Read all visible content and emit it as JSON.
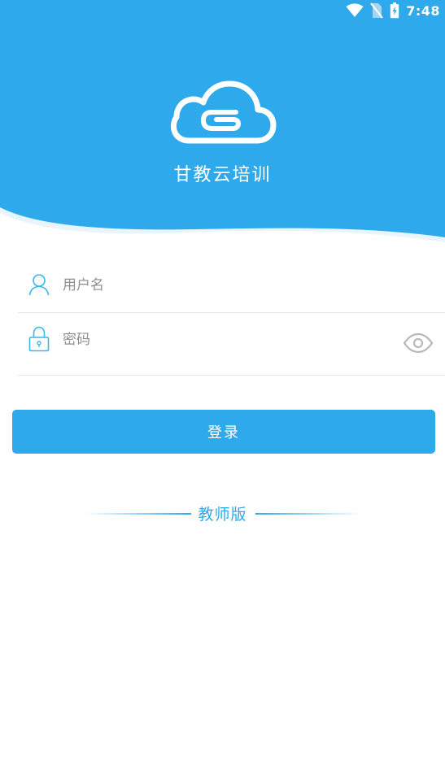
{
  "status_bar": {
    "time": "7:48",
    "icons": [
      "wifi-icon",
      "no-sim-icon",
      "battery-charging-icon"
    ]
  },
  "header": {
    "logo": "cloud-g-logo",
    "app_title": "甘教云培训"
  },
  "form": {
    "username": {
      "icon": "user-icon",
      "placeholder": "用户名",
      "value": ""
    },
    "password": {
      "icon": "lock-icon",
      "placeholder": "密码",
      "value": "",
      "toggle_icon": "eye-icon"
    }
  },
  "login_button": {
    "label": "登录"
  },
  "edition": {
    "label": "教师版"
  },
  "colors": {
    "primary": "#2ea9ec",
    "header_bg": "#2ea9ec",
    "icon_outline": "#3bb5ee",
    "divider": "#e6e6e6",
    "placeholder": "#8e8e8e",
    "eye_icon": "#b9b9b9"
  }
}
